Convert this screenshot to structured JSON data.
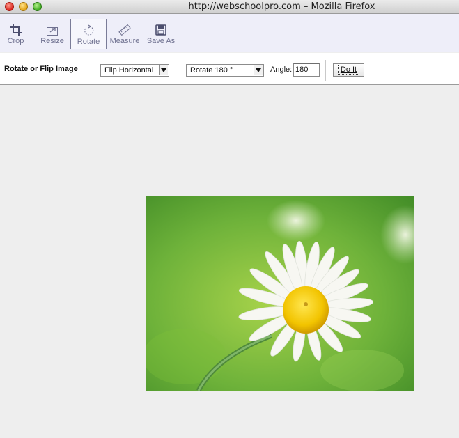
{
  "window": {
    "title": "http://webschoolpro.com – Mozilla Firefox"
  },
  "toolbar": {
    "tools": [
      {
        "label": "Crop",
        "icon": "crop-icon"
      },
      {
        "label": "Resize",
        "icon": "resize-icon"
      },
      {
        "label": "Rotate",
        "icon": "rotate-icon",
        "active": true
      },
      {
        "label": "Measure",
        "icon": "ruler-icon"
      },
      {
        "label": "Save As",
        "icon": "floppy-disk-icon"
      }
    ]
  },
  "options": {
    "title": "Rotate or Flip Image",
    "flip_select": "Flip Horizontal",
    "rotate_select": "Rotate 180 °",
    "angle_label": "Angle:",
    "angle_value": "180",
    "do_it_label": "Do It"
  },
  "image": {
    "alt": "daisy-photo"
  }
}
